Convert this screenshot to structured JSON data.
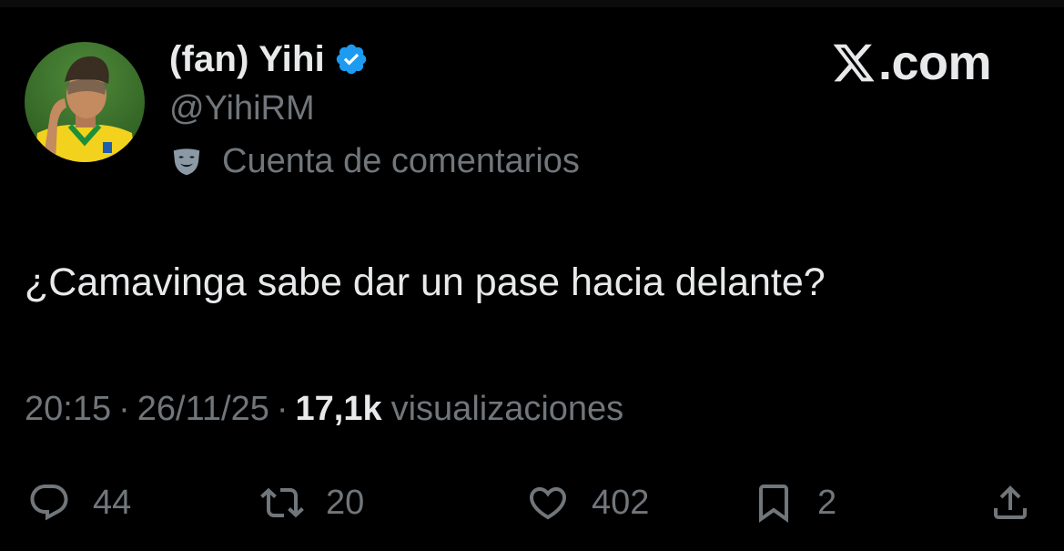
{
  "brand": {
    "label": ".com",
    "icon": "x-logo-icon"
  },
  "author": {
    "display_name": "(fan) Yihi",
    "handle": "@YihiRM",
    "verified": true,
    "avatar_icon": "profile-avatar",
    "account_label": "Cuenta de comentarios",
    "account_label_icon": "theater-mask-icon"
  },
  "tweet": {
    "text": "¿Camavinga sabe dar un pase hacia delante?",
    "time": "20:15",
    "separator": "·",
    "date": "26/11/25",
    "views_count": "17,1k",
    "views_label": "visualizaciones"
  },
  "actions": {
    "replies": "44",
    "retweets": "20",
    "likes": "402",
    "bookmarks": "2"
  },
  "colors": {
    "background": "#000000",
    "primary_text": "#e7e9ea",
    "secondary_text": "#71767b",
    "verified_blue": "#1d9bf0"
  }
}
